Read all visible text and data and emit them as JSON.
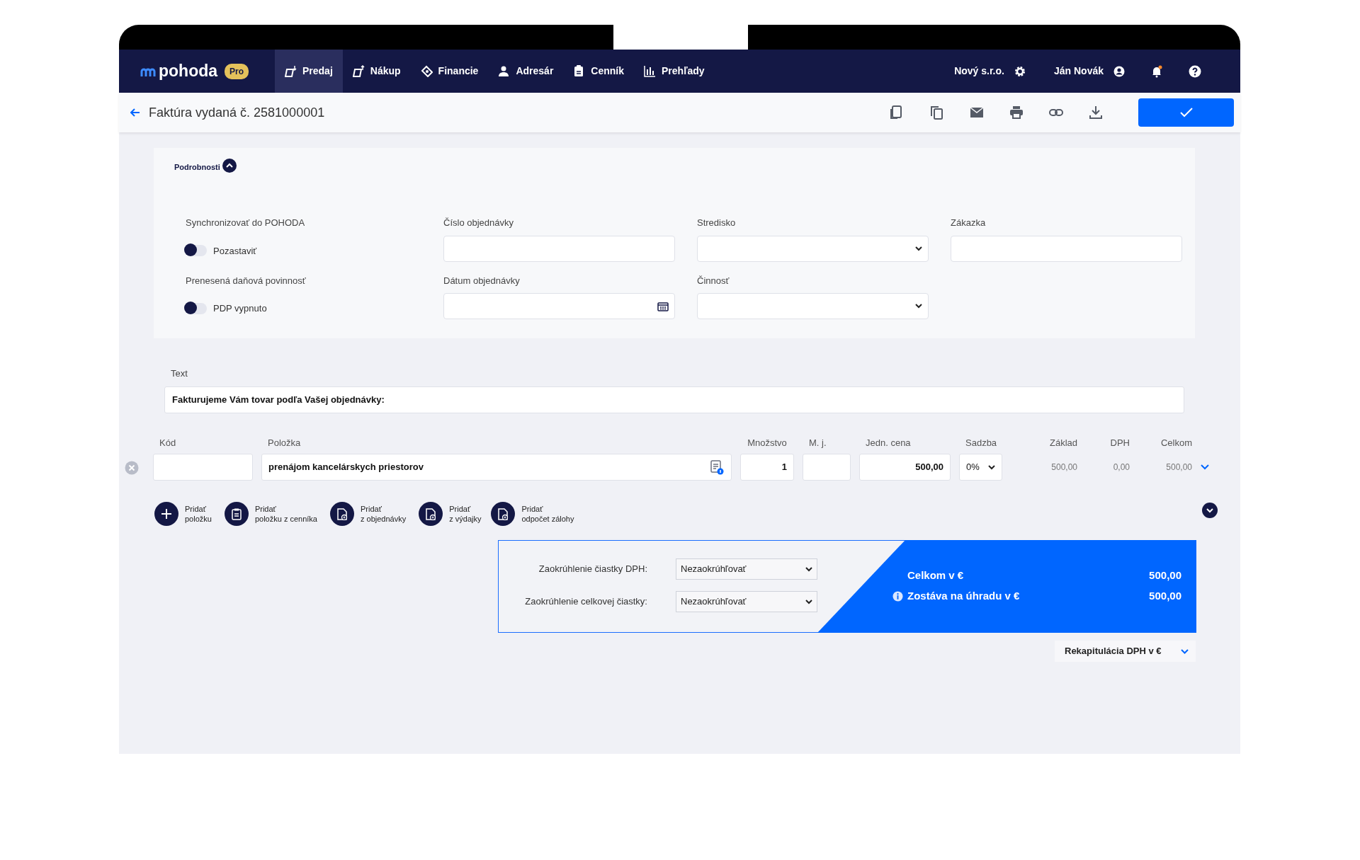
{
  "nav": {
    "logo": "pohoda",
    "badge": "Pro",
    "items": [
      {
        "label": "Predaj",
        "kind": "sell",
        "selected": true
      },
      {
        "label": "Nákup",
        "kind": "buy",
        "selected": false
      },
      {
        "label": "Financie",
        "kind": "finance",
        "selected": false
      },
      {
        "label": "Adresár",
        "kind": "person",
        "selected": false
      },
      {
        "label": "Cenník",
        "kind": "clipboard",
        "selected": false
      },
      {
        "label": "Prehľady",
        "kind": "chart",
        "selected": false
      }
    ],
    "company": "Nový s.r.o.",
    "user": "Ján Novák",
    "notification": true
  },
  "toolbar": {
    "title": "Faktúra vydaná č. 2581000001"
  },
  "details": {
    "title": "Podrobnosti",
    "expanded": true,
    "switches": [
      {
        "label": "Synchronizovať do POHODA",
        "text": "Pozastaviť",
        "on": false
      },
      {
        "label": "Prenesená daňová povinnosť",
        "text": "PDP vypnuto",
        "on": false
      }
    ],
    "fields": [
      {
        "label": "Číslo objednávky",
        "kind": "text"
      },
      {
        "label": "Stredisko",
        "kind": "select"
      },
      {
        "label": "Zákazka",
        "kind": "text"
      },
      {
        "label": "Dátum objednávky",
        "kind": "date"
      },
      {
        "label": "Činnosť",
        "kind": "select"
      }
    ]
  },
  "text": {
    "label": "Text",
    "value": "Fakturujeme Vám tovar podľa Vašej objednávky:"
  },
  "items": {
    "columns": [
      "Kód",
      "Položka",
      "Množstvo",
      "M. j.",
      "Jedn. cena",
      "Sadzba",
      "Základ",
      "DPH",
      "Celkom"
    ],
    "rows": [
      {
        "name": "prenájom kancelárskych priestorov",
        "quantity": "1",
        "price": "500,00",
        "rate": "0%",
        "base": "500,00",
        "vat": "0,00",
        "total": "500,00"
      }
    ]
  },
  "add_buttons": [
    {
      "lines": [
        "Pridať",
        "položku"
      ],
      "kind": "plus"
    },
    {
      "lines": [
        "Pridať",
        "položku z cenníka"
      ],
      "kind": "clipboard"
    },
    {
      "lines": [
        "Pridať",
        "z objednávky"
      ],
      "kind": "doc"
    },
    {
      "lines": [
        "Pridať",
        "z výdajky"
      ],
      "kind": "doc"
    },
    {
      "lines": [
        "Pridať",
        "odpočet zálohy"
      ],
      "kind": "doc"
    }
  ],
  "rounding": [
    {
      "label": "Zaokrúhlenie čiastky DPH:",
      "value": "Nezaokrúhľovať"
    },
    {
      "label": "Zaokrúhlenie celkovej čiastky:",
      "value": "Nezaokrúhľovať"
    }
  ],
  "totals": [
    {
      "label": "Celkom v €",
      "value": "500,00",
      "info": false
    },
    {
      "label": "Zostáva na úhradu v €",
      "value": "500,00",
      "info": true
    }
  ],
  "recap": {
    "label": "Rekapitulácia DPH v €",
    "expanded": false
  }
}
